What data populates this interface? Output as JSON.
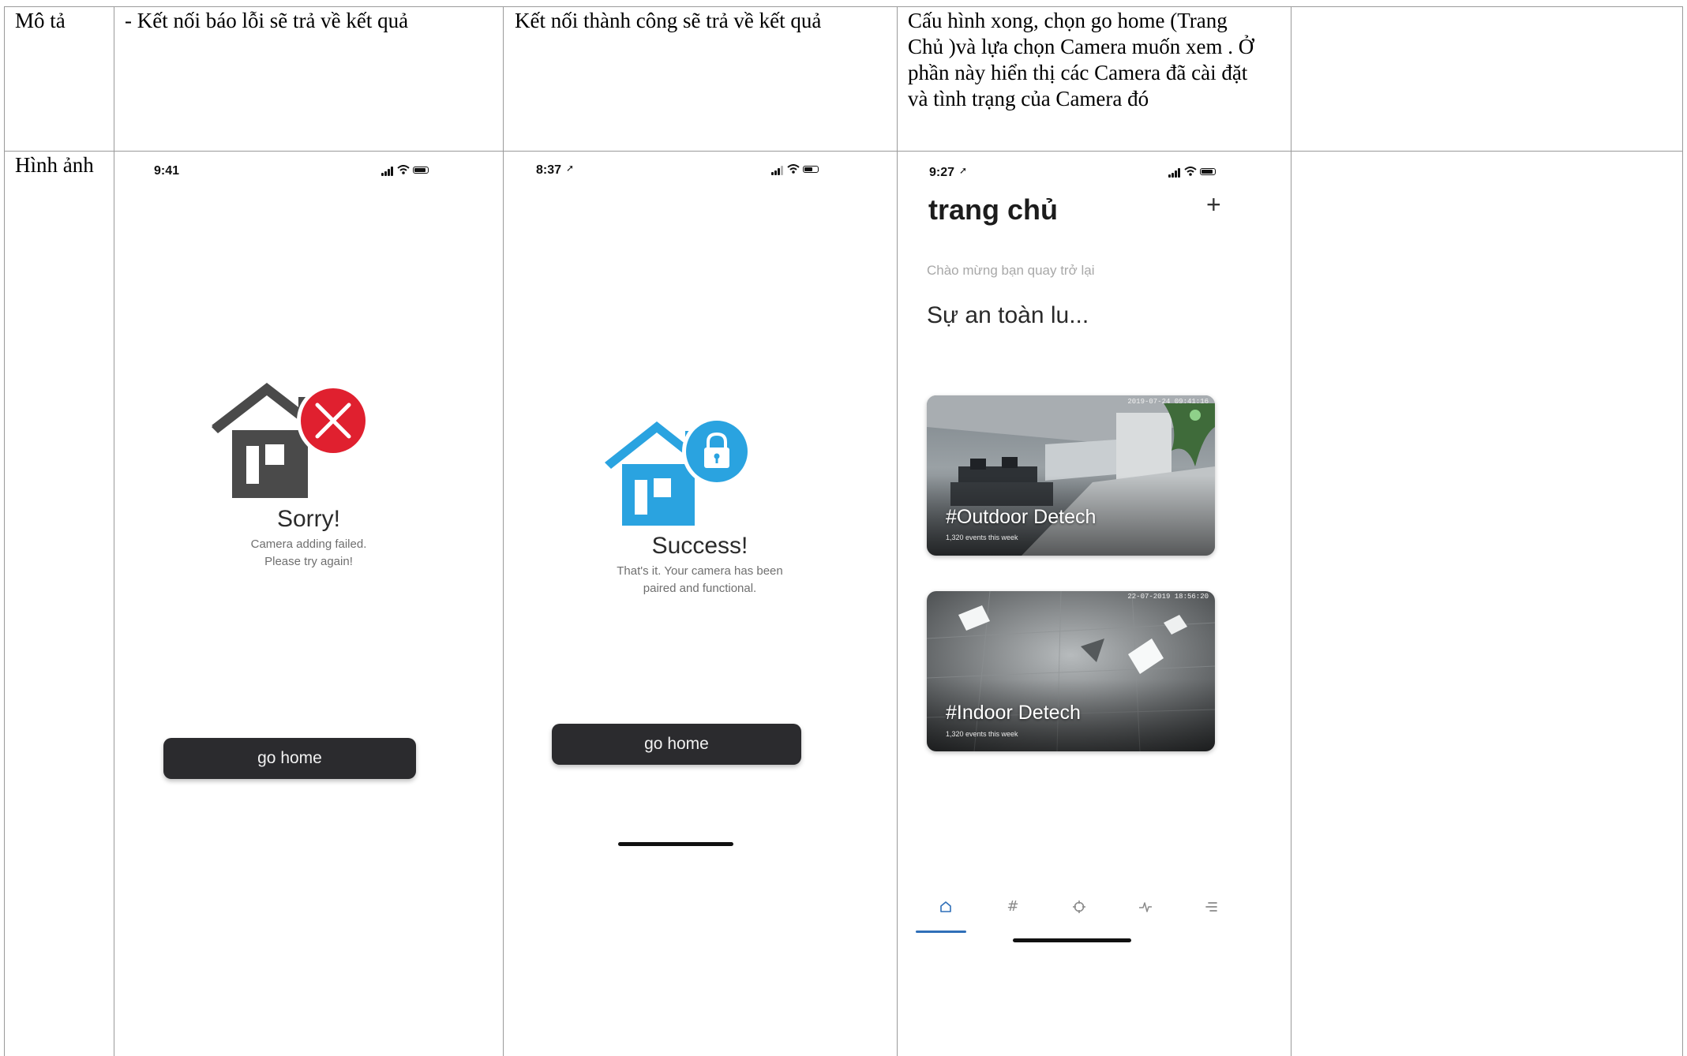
{
  "table": {
    "row1_label": "Mô tả",
    "row2_label": "Hình ảnh",
    "col1_desc": "- Kết nối báo lỗi sẽ trả về kết quả",
    "col2_desc": "Kết nối thành công sẽ trả về kết quả",
    "col3_desc_lines": [
      "Cấu hình xong, chọn go home (Trang",
      "Chủ )và lựa chọn Camera muốn xem  . Ở",
      "phần này hiển thị các Camera đã cài đặt",
      "và tình trạng của Camera đó"
    ]
  },
  "screen_fail": {
    "time": "9:41",
    "title": "Sorry!",
    "message": "Camera adding failed.\nPlease try again!",
    "button_label": "go home",
    "house_color": "#4a4a4a",
    "badge_color": "#e0202f"
  },
  "screen_success": {
    "time": "8:37",
    "title": "Success!",
    "message": "That's it. Your camera has been\npaired and functional.",
    "button_label": "go home",
    "house_color": "#2aa3e0"
  },
  "screen_home": {
    "time": "9:27",
    "title": "trang chủ",
    "add_symbol": "+",
    "welcome": "Chào mừng bạn quay trở lại",
    "headline": "Sự an toàn lu...",
    "cameras": [
      {
        "name": "#Outdoor Detech",
        "events": "1,320 events this week",
        "stamp": "2019-07-24 09:41:16"
      },
      {
        "name": "#Indoor Detech",
        "events": "1,320 events this week",
        "stamp": "22-07-2019 18:56:20"
      }
    ],
    "tabs": [
      "home-icon",
      "hashtag-icon",
      "crosshair-icon",
      "activity-icon",
      "menu-icon"
    ],
    "accent_color": "#2f6fb8"
  }
}
